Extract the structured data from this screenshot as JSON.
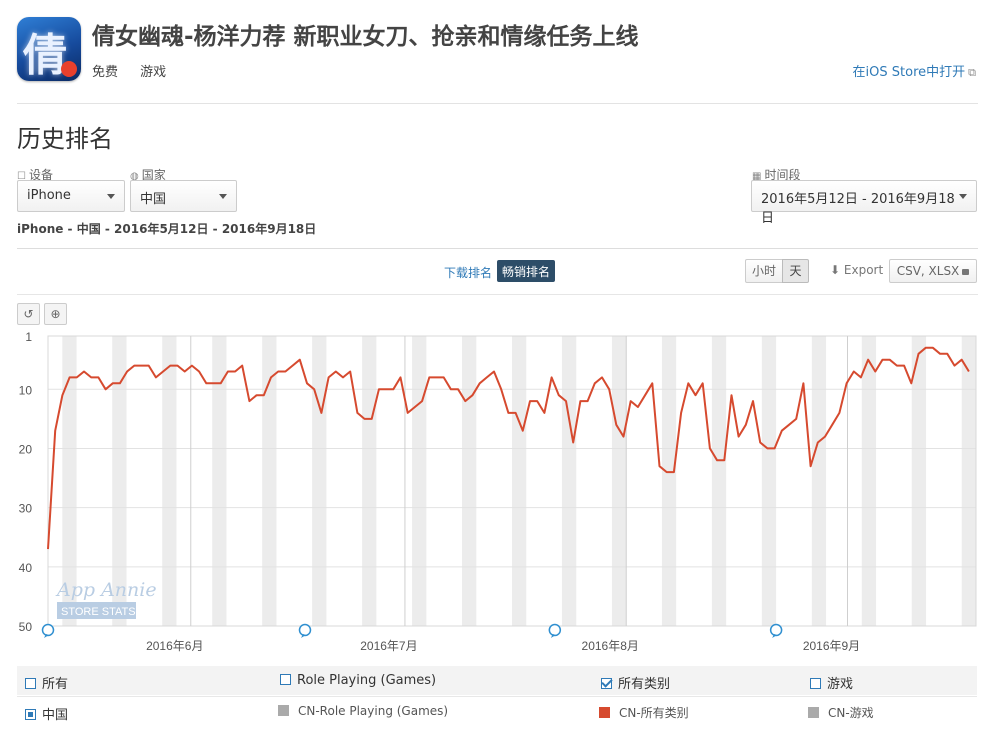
{
  "app": {
    "title": "倩女幽魂-杨洋力荐 新职业女刀、抢亲和情缘任务上线",
    "icon_glyph": "倩",
    "price": "免费",
    "category": "游戏",
    "store_link": "在iOS Store中打开",
    "store_link_icon": "external-link-icon"
  },
  "section_title": "历史排名",
  "filters": {
    "device_label": "设备",
    "device_value": "iPhone",
    "country_label": "国家",
    "country_value": "中国",
    "period_label": "时间段",
    "period_value": "2016年5月12日 - 2016年9月18日"
  },
  "subtitle": "iPhone - 中国 - 2016年5月12日 - 2016年9月18日",
  "tabs": {
    "download": "下载排名",
    "grossing": "畅销排名"
  },
  "granularity": {
    "hour": "小时",
    "day": "天"
  },
  "export": {
    "label": "Export",
    "formats": "CSV, XLSX"
  },
  "watermark": {
    "line1": "App Annie",
    "line2": "STORE STATS"
  },
  "chart_data": {
    "type": "line",
    "title": "",
    "xlabel": "",
    "ylabel": "",
    "y_reversed": true,
    "ylim": [
      1,
      50
    ],
    "yticks": [
      1,
      10,
      20,
      30,
      40,
      50
    ],
    "xlim": [
      "2016-05-12",
      "2016-09-18"
    ],
    "xtick_labels": [
      {
        "date": "2016-06-01",
        "label": "2016年6月"
      },
      {
        "date": "2016-07-01",
        "label": "2016年7月"
      },
      {
        "date": "2016-08-01",
        "label": "2016年8月"
      },
      {
        "date": "2016-09-01",
        "label": "2016年9月"
      }
    ],
    "weekend_bands": true,
    "annotation_markers": [
      "2016-05-12",
      "2016-06-17",
      "2016-07-22",
      "2016-08-22"
    ],
    "color": "#d64a2f",
    "series": [
      {
        "name": "CN-所有类别",
        "start": "2016-05-12",
        "values": [
          37,
          17,
          11,
          8,
          8,
          7,
          8,
          8,
          10,
          9,
          9,
          7,
          6,
          6,
          6,
          8,
          7,
          6,
          6,
          7,
          6,
          7,
          9,
          9,
          9,
          7,
          7,
          6,
          12,
          11,
          11,
          8,
          7,
          7,
          6,
          5,
          9,
          10,
          14,
          8,
          7,
          8,
          7,
          14,
          15,
          15,
          10,
          10,
          10,
          8,
          14,
          13,
          12,
          8,
          8,
          8,
          10,
          10,
          12,
          11,
          9,
          8,
          7,
          10,
          14,
          14,
          17,
          12,
          12,
          14,
          8,
          11,
          12,
          19,
          12,
          12,
          9,
          8,
          10,
          16,
          18,
          12,
          13,
          11,
          9,
          23,
          24,
          24,
          14,
          9,
          11,
          9,
          20,
          22,
          22,
          11,
          18,
          16,
          12,
          19,
          20,
          20,
          17,
          16,
          15,
          9,
          23,
          19,
          18,
          16,
          14,
          9,
          7,
          8,
          5,
          7,
          5,
          5,
          6,
          6,
          9,
          4,
          3,
          3,
          4,
          4,
          6,
          5,
          7
        ]
      }
    ]
  },
  "legend": {
    "row1": [
      {
        "label": "所有",
        "checked": false
      },
      {
        "label": "Role Playing (Games)",
        "checked": false
      },
      {
        "label": "所有类别",
        "checked": true
      },
      {
        "label": "游戏",
        "checked": false
      }
    ],
    "row2": [
      {
        "label": "中国",
        "color": "#2f7ab7"
      },
      {
        "label": "CN-Role Playing (Games)",
        "color": "#aaaaaa"
      },
      {
        "label": "CN-所有类别",
        "color": "#d64a2f"
      },
      {
        "label": "CN-游戏",
        "color": "#aaaaaa"
      }
    ]
  }
}
